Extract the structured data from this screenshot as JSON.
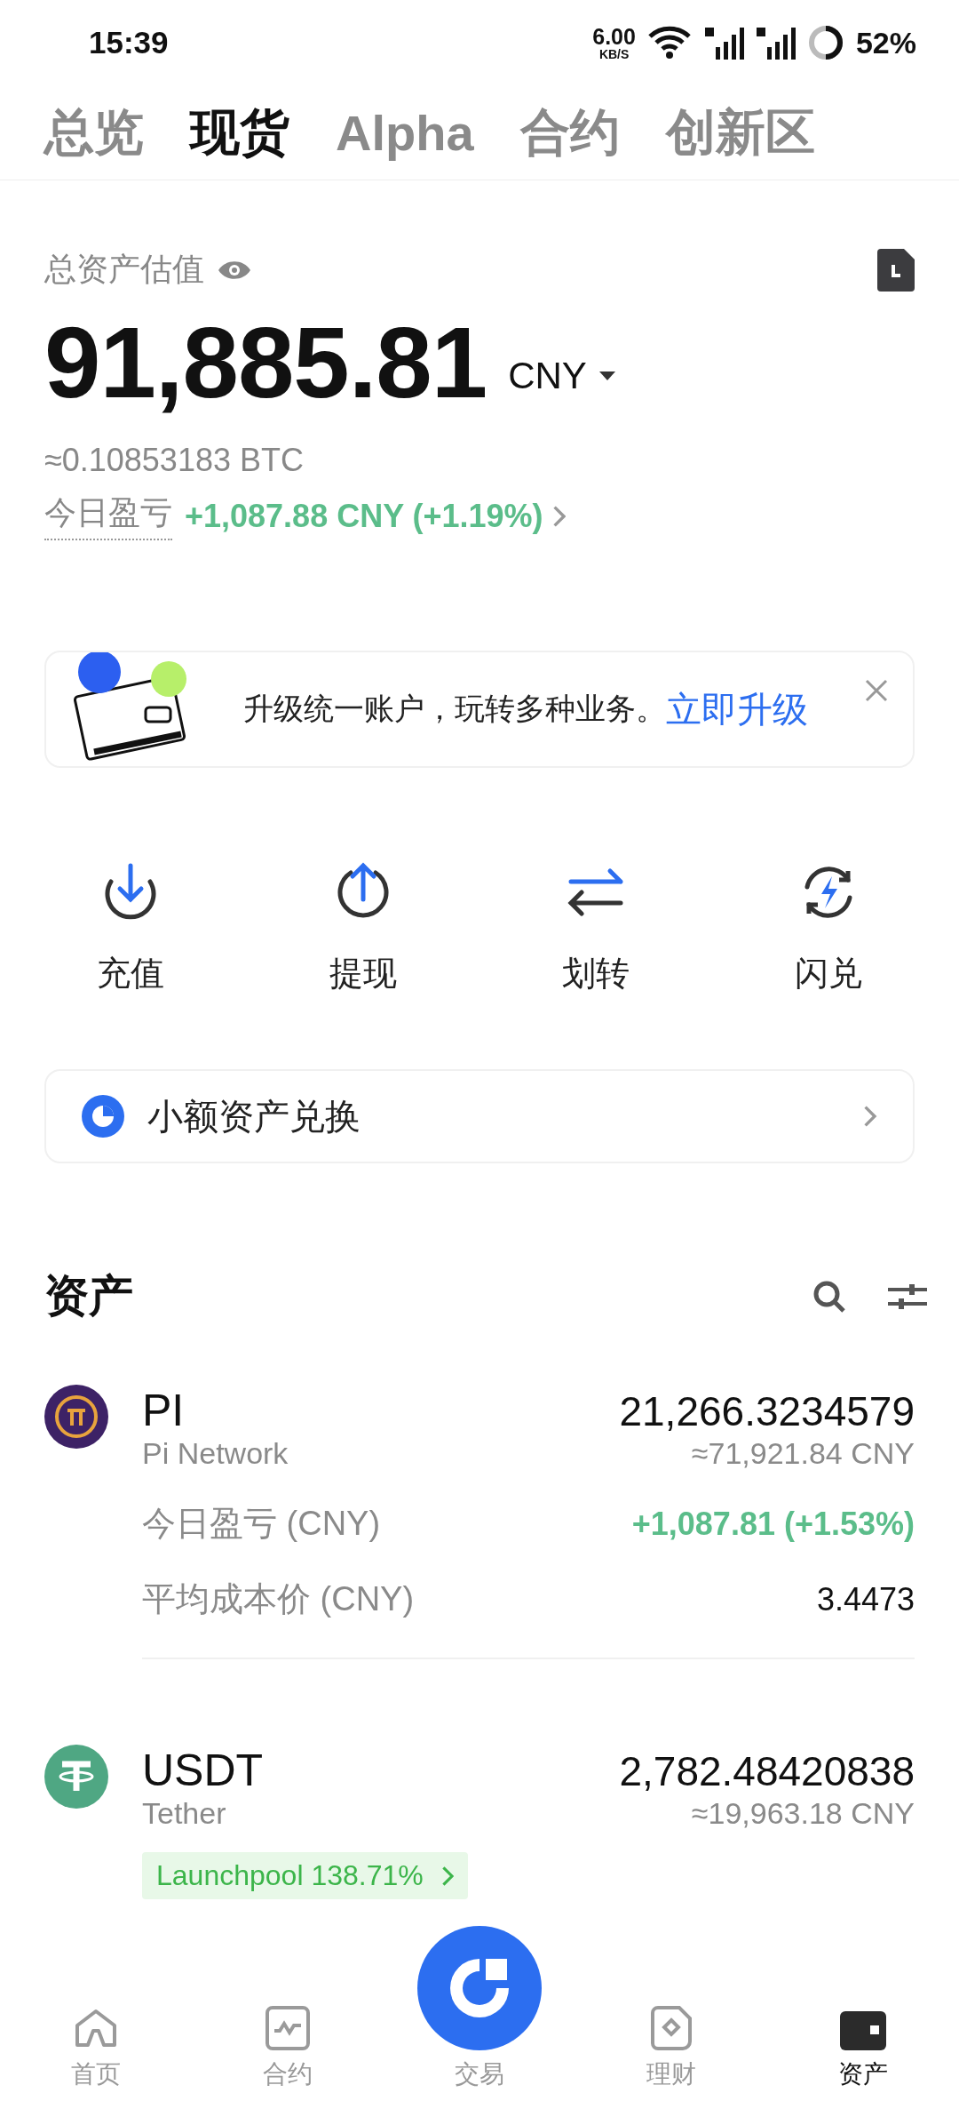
{
  "status_bar": {
    "time": "15:39",
    "net_speed": "6.00",
    "net_unit": "KB/S",
    "battery": "52%"
  },
  "tabs": [
    {
      "label": "总览",
      "selected": false
    },
    {
      "label": "现货",
      "selected": true
    },
    {
      "label": "Alpha",
      "selected": false
    },
    {
      "label": "合约",
      "selected": false
    },
    {
      "label": "创新区",
      "selected": false
    }
  ],
  "overview": {
    "label": "总资产估值",
    "amount": "91,885.81",
    "currency": "CNY",
    "btc": "≈0.10853183 BTC",
    "pnl_label": "今日盈亏",
    "pnl_value": "+1,087.88 CNY (+1.19%)"
  },
  "banner": {
    "text": "升级统一账户，玩转多种业务。",
    "link": "立即升级"
  },
  "actions": [
    {
      "label": "充值",
      "kind": "deposit"
    },
    {
      "label": "提现",
      "kind": "withdraw"
    },
    {
      "label": "划转",
      "kind": "transfer"
    },
    {
      "label": "闪兑",
      "kind": "convert"
    }
  ],
  "dust": {
    "label": "小额资产兑换"
  },
  "assets": {
    "title": "资产",
    "items": [
      {
        "kind": "pi",
        "symbol": "PI",
        "name": "Pi Network",
        "amount": "21,266.3234579",
        "value": "≈71,921.84 CNY",
        "details": [
          {
            "label": "今日盈亏 (CNY)",
            "value": "+1,087.81 (+1.53%)",
            "positive": true
          },
          {
            "label": "平均成本价 (CNY)",
            "value": "3.4473",
            "positive": false
          }
        ]
      },
      {
        "kind": "usdt",
        "symbol": "USDT",
        "name": "Tether",
        "amount": "2,782.48420838",
        "value": "≈19,963.18 CNY",
        "tag": "Launchpool 138.71%"
      }
    ]
  },
  "nav": [
    {
      "label": "首页",
      "kind": "home",
      "selected": false
    },
    {
      "label": "合约",
      "kind": "futures",
      "selected": false
    },
    {
      "label": "交易",
      "kind": "trade",
      "selected": false
    },
    {
      "label": "理财",
      "kind": "earn",
      "selected": false
    },
    {
      "label": "资产",
      "kind": "assets",
      "selected": true
    }
  ]
}
